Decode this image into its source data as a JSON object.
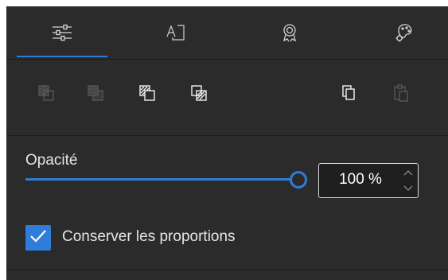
{
  "tabs": [
    {
      "icon": "sliders-icon",
      "active": true
    },
    {
      "icon": "text-frame-icon",
      "active": false
    },
    {
      "icon": "award-badge-icon",
      "active": false
    },
    {
      "icon": "palette-settings-icon",
      "active": false
    }
  ],
  "toolbar": {
    "buttons": [
      {
        "icon": "bring-to-front-icon",
        "enabled": false
      },
      {
        "icon": "send-to-back-icon",
        "enabled": false
      },
      {
        "icon": "bring-forward-icon",
        "enabled": true
      },
      {
        "icon": "send-backward-icon",
        "enabled": true
      },
      {
        "icon": "copy-icon",
        "enabled": true
      },
      {
        "icon": "paste-icon",
        "enabled": false
      }
    ]
  },
  "opacity": {
    "label": "Opacité",
    "value_text": "100 %",
    "level": 1.0
  },
  "keep_proportions": {
    "label": "Conserver les proportions",
    "checked": true
  },
  "colors": {
    "accent": "#2f7dd8",
    "panel_bg": "#2b2b2b",
    "text": "#e6e6e6",
    "disabled_icon": "#5a5a5a"
  }
}
